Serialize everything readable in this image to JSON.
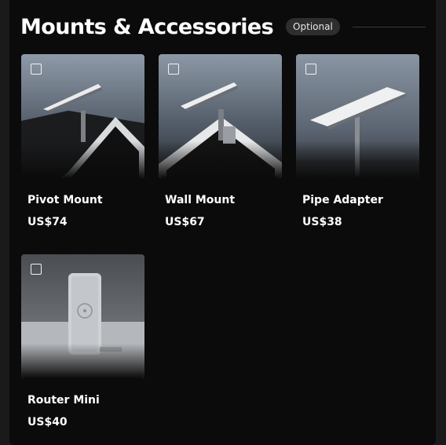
{
  "section": {
    "title": "Mounts & Accessories",
    "badge": "Optional"
  },
  "products": [
    {
      "name": "Pivot Mount",
      "price": "US$74",
      "image": "pivot-mount-photo",
      "selected": false
    },
    {
      "name": "Wall Mount",
      "price": "US$67",
      "image": "wall-mount-photo",
      "selected": false
    },
    {
      "name": "Pipe Adapter",
      "price": "US$38",
      "image": "pipe-adapter-photo",
      "selected": false
    },
    {
      "name": "Router Mini",
      "price": "US$40",
      "image": "router-mini-photo",
      "selected": false
    }
  ]
}
